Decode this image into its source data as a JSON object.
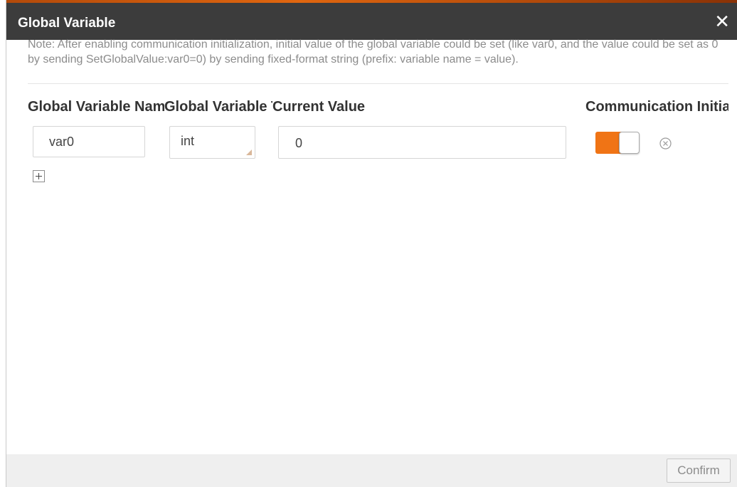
{
  "window": {
    "title": "Global Variable",
    "close_glyph": "✕",
    "accent_color": "#e0660f"
  },
  "note": "Note: After enabling communication initialization, initial value of the global variable could be set (like var0, and the value could be set as 0 by sending SetGlobalValue:var0=0) by sending fixed-format string (prefix: variable name = value).",
  "table": {
    "columns": [
      {
        "label": "Global Variable Name"
      },
      {
        "label": "Global Variable Type"
      },
      {
        "label": "Current Value"
      },
      {
        "label": "Communication Initialization"
      }
    ],
    "rows": [
      {
        "name": "var0",
        "type": "int",
        "value": "0",
        "comm_init_enabled": true
      }
    ]
  },
  "icons": {
    "add": "plus-icon",
    "remove": "remove-circle-icon",
    "close": "close-icon"
  },
  "colors": {
    "toggle_on": "#f07415",
    "titlebar": "#3c3c3c"
  },
  "footer": {
    "confirm_label": "Confirm"
  }
}
